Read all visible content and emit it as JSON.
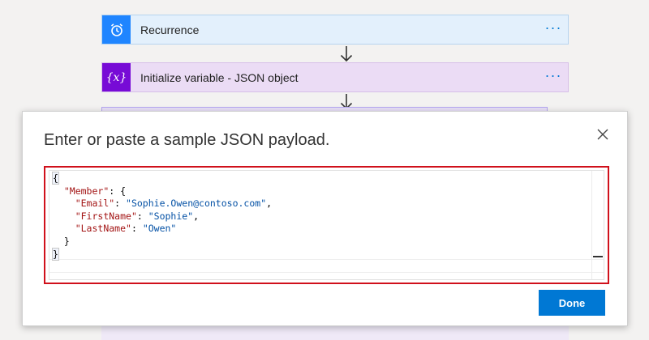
{
  "flow": {
    "steps": [
      {
        "title": "Recurrence",
        "more": "···",
        "icon": "alarm-clock-icon",
        "color": "#1f85ff"
      },
      {
        "title": "Initialize variable - JSON object",
        "more": "···",
        "icon": "variable-icon",
        "icon_text": "{x}",
        "color": "#770bd6"
      }
    ]
  },
  "dialog": {
    "title": "Enter or paste a sample JSON payload.",
    "close_icon": "close-icon",
    "done_label": "Done",
    "accent_color": "#0078d4",
    "highlight_color": "#d0101b"
  },
  "payload": {
    "open_brace": "{",
    "member_key": "\"Member\"",
    "member_open": ": {",
    "email_key": "\"Email\"",
    "email_value": "\"Sophie.Owen@contoso.com\"",
    "firstname_key": "\"FirstName\"",
    "firstname_value": "\"Sophie\"",
    "lastname_key": "\"LastName\"",
    "lastname_value": "\"Owen\"",
    "inner_close": "}",
    "close_brace": "}"
  }
}
